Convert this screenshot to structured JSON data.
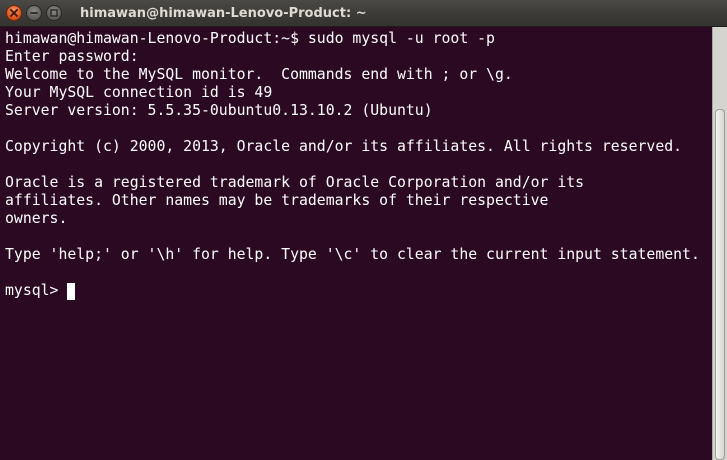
{
  "window": {
    "title": "himawan@himawan-Lenovo-Product: ~",
    "close_icon": "close-icon",
    "minimize_icon": "minimize-icon",
    "maximize_icon": "maximize-icon"
  },
  "terminal": {
    "lines": [
      "himawan@himawan-Lenovo-Product:~$ sudo mysql -u root -p",
      "Enter password: ",
      "Welcome to the MySQL monitor.  Commands end with ; or \\g.",
      "Your MySQL connection id is 49",
      "Server version: 5.5.35-0ubuntu0.13.10.2 (Ubuntu)",
      "",
      "Copyright (c) 2000, 2013, Oracle and/or its affiliates. All rights reserved.",
      "",
      "Oracle is a registered trademark of Oracle Corporation and/or its",
      "affiliates. Other names may be trademarks of their respective",
      "owners.",
      "",
      "Type 'help;' or '\\h' for help. Type '\\c' to clear the current input statement.",
      ""
    ],
    "prompt": "mysql>"
  },
  "colors": {
    "terminal_background": "#2c0922",
    "terminal_text": "#ffffff",
    "close_button": "#e0561f"
  }
}
